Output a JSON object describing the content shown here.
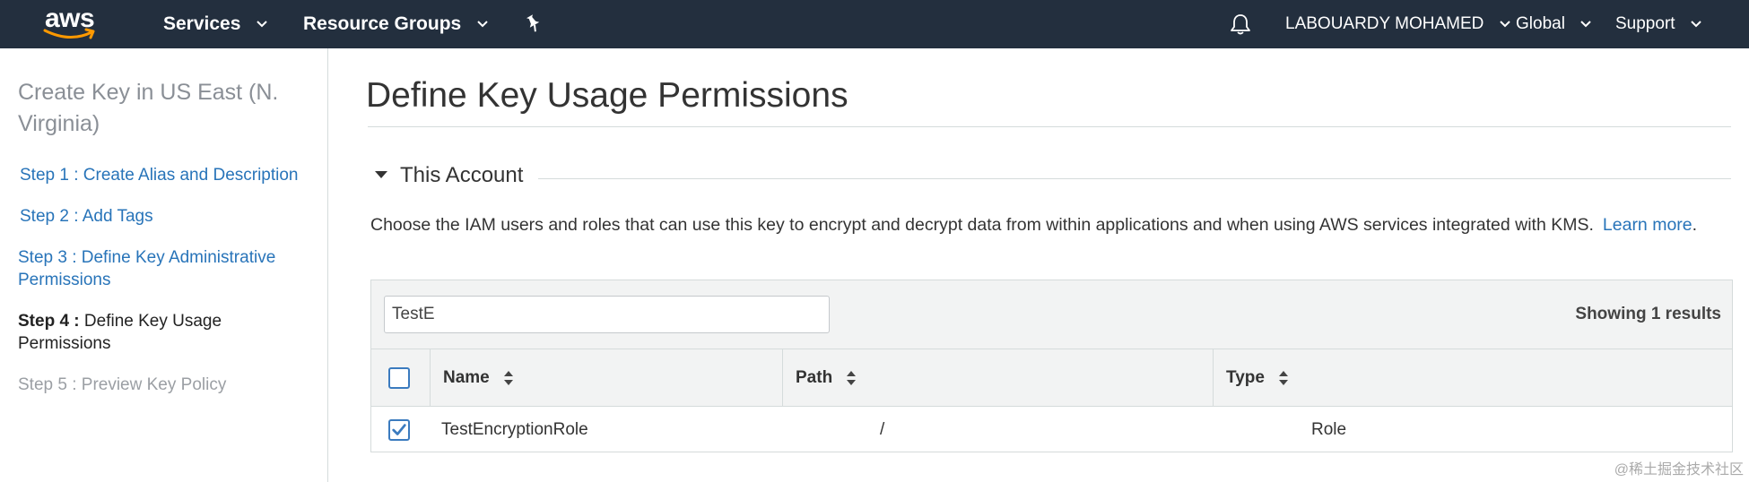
{
  "topbar": {
    "logo_text": "aws",
    "services_label": "Services",
    "resource_groups_label": "Resource Groups",
    "account_label": "LABOUARDY MOHAMED",
    "region_label": "Global",
    "support_label": "Support"
  },
  "sidebar": {
    "title": "Create Key in US East (N. Virginia)",
    "steps": [
      {
        "prefix": "",
        "label": "Step 1 : Create Alias and Description",
        "state": "done"
      },
      {
        "prefix": "",
        "label": "Step 2 : Add Tags",
        "state": "done"
      },
      {
        "prefix": "",
        "label": "Step 3 : Define Key Administrative Permissions",
        "state": "done"
      },
      {
        "prefix": "Step 4 :",
        "label": " Define Key Usage Permissions",
        "state": "current"
      },
      {
        "prefix": "",
        "label": "Step 5 : Preview Key Policy",
        "state": "future"
      }
    ]
  },
  "main": {
    "title": "Define Key Usage Permissions",
    "section_title": "This Account",
    "description": "Choose the IAM users and roles that can use this key to encrypt and decrypt data from within applications and when using AWS services integrated with KMS.",
    "learn_more": "Learn more",
    "desc_period": "."
  },
  "table": {
    "search_value": "TestE",
    "showing": "Showing 1 results",
    "columns": [
      "Name",
      "Path",
      "Type"
    ],
    "rows": [
      {
        "name": "TestEncryptionRole",
        "path": "/",
        "type": "Role",
        "checked": true
      }
    ]
  },
  "watermark": "@稀土掘金技术社区",
  "colors": {
    "topbar": "#232f3e",
    "link": "#2874b9",
    "checkbox": "#3b7bbf"
  }
}
